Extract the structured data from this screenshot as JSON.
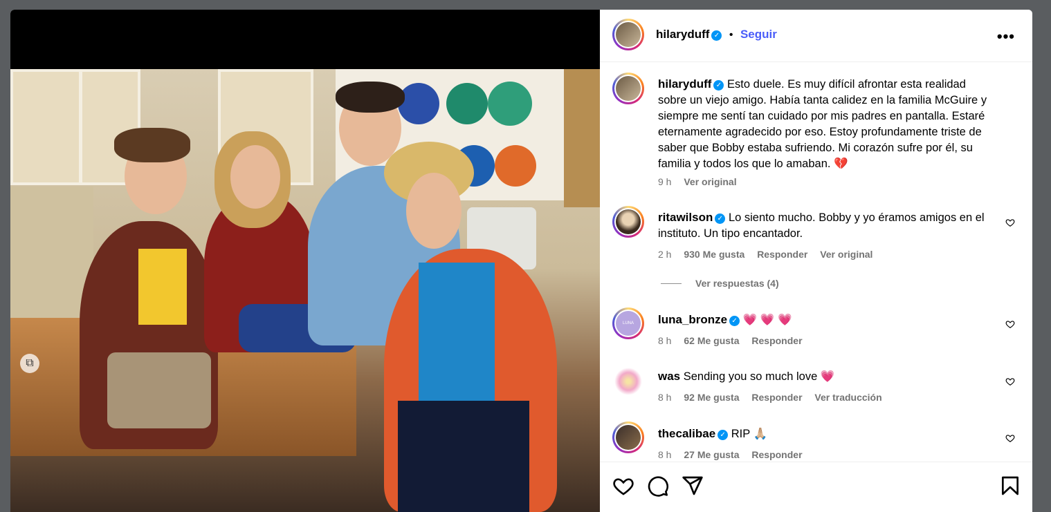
{
  "post": {
    "author": "hilaryduff",
    "follow_label": "Seguir",
    "separator": "•"
  },
  "caption": {
    "user": "hilaryduff",
    "text": "Esto duele. Es muy difícil afrontar esta realidad sobre un viejo amigo. Había tanta calidez en la familia McGuire y siempre me sentí tan cuidado por mis padres en pantalla. Estaré eternamente agradecido por eso. Estoy profundamente triste de saber que Bobby estaba sufriendo. Mi corazón sufre por él, su familia y todos los que lo amaban. 💔",
    "time": "9 h",
    "see_original": "Ver original"
  },
  "comments": [
    {
      "user": "ritawilson",
      "verified": true,
      "text": "Lo siento mucho. Bobby y yo éramos amigos en el instituto. Un tipo encantador.",
      "time": "2 h",
      "likes": "930 Me gusta",
      "reply": "Responder",
      "extra": "Ver original"
    },
    {
      "user": "luna_bronze",
      "verified": true,
      "text": "💗 💗 💗",
      "time": "8 h",
      "likes": "62 Me gusta",
      "reply": "Responder",
      "extra": ""
    },
    {
      "user": "was",
      "verified": false,
      "text": "Sending you so much love 💗",
      "time": "8 h",
      "likes": "92 Me gusta",
      "reply": "Responder",
      "extra": "Ver traducción"
    },
    {
      "user": "thecalibae",
      "verified": true,
      "text": "RIP 🙏🏼",
      "time": "8 h",
      "likes": "27 Me gusta",
      "reply": "Responder",
      "extra": ""
    }
  ],
  "view_replies": "Ver respuestas (4)",
  "avatar_texts": {
    "luna_bronze": "LUNA BRONZE"
  },
  "colors": {
    "accent": "#0095f6",
    "follow": "#4a5df9",
    "meta": "#737373"
  }
}
